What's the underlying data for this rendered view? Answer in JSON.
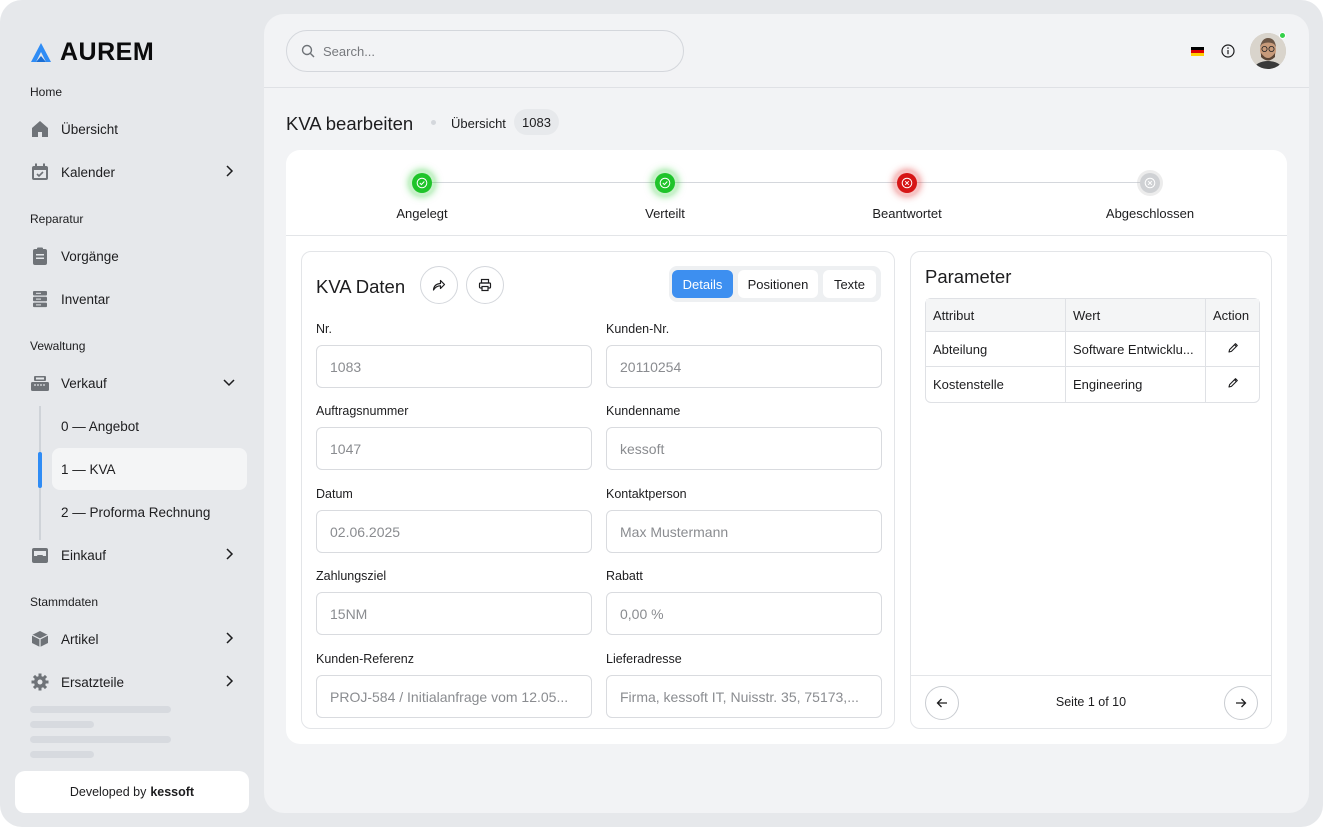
{
  "brand": {
    "name": "AUREM"
  },
  "sidebar": {
    "sections": {
      "home": "Home",
      "reparatur": "Reparatur",
      "verwaltung": "Vewaltung",
      "stammdaten": "Stammdaten"
    },
    "items": {
      "uebersicht": "Übersicht",
      "kalender": "Kalender",
      "vorgaenge": "Vorgänge",
      "inventar": "Inventar",
      "verkauf": "Verkauf",
      "angebot": "0 — Angebot",
      "kva": "1 — KVA",
      "proforma": "2 — Proforma Rechnung",
      "einkauf": "Einkauf",
      "artikel": "Artikel",
      "ersatzteile": "Ersatzteile"
    },
    "footer": {
      "prefix": "Developed by",
      "company": "kessoft"
    }
  },
  "topbar": {
    "search_placeholder": "Search..."
  },
  "page": {
    "title": "KVA bearbeiten",
    "breadcrumb": "Übersicht",
    "id_badge": "1083"
  },
  "steps": [
    {
      "label": "Angelegt",
      "state": "done"
    },
    {
      "label": "Verteilt",
      "state": "done"
    },
    {
      "label": "Beantwortet",
      "state": "error"
    },
    {
      "label": "Abgeschlossen",
      "state": "pending"
    }
  ],
  "colors": {
    "done": "#1fc42a",
    "error": "#d61616",
    "pending": "#cfd1d4",
    "accent": "#3d8ff0"
  },
  "form": {
    "title": "KVA Daten",
    "tabs": {
      "details": "Details",
      "positionen": "Positionen",
      "texte": "Texte"
    },
    "fields": {
      "nr": {
        "label": "Nr.",
        "value": "1083"
      },
      "kunden_nr": {
        "label": "Kunden-Nr.",
        "value": "20110254"
      },
      "auftragsnummer": {
        "label": "Auftragsnummer",
        "value": "1047"
      },
      "kundenname": {
        "label": "Kundenname",
        "value": "kessoft"
      },
      "datum": {
        "label": "Datum",
        "value": "02.06.2025"
      },
      "kontaktperson": {
        "label": "Kontaktperson",
        "value": "Max Mustermann"
      },
      "zahlungsziel": {
        "label": "Zahlungsziel",
        "value": "15NM"
      },
      "rabatt": {
        "label": "Rabatt",
        "value": "0,00 %"
      },
      "kunden_referenz": {
        "label": "Kunden-Referenz",
        "value": "PROJ-584 / Initialanfrage vom 12.05..."
      },
      "lieferadresse": {
        "label": "Lieferadresse",
        "value": "Firma, kessoft IT, Nuisstr. 35, 75173,..."
      }
    }
  },
  "parameter": {
    "title": "Parameter",
    "columns": {
      "attribut": "Attribut",
      "wert": "Wert",
      "action": "Action"
    },
    "rows": [
      {
        "attribut": "Abteilung",
        "wert": "Software Entwicklu..."
      },
      {
        "attribut": "Kostenstelle",
        "wert": "Engineering"
      }
    ],
    "pagination": "Seite 1 of 10"
  }
}
